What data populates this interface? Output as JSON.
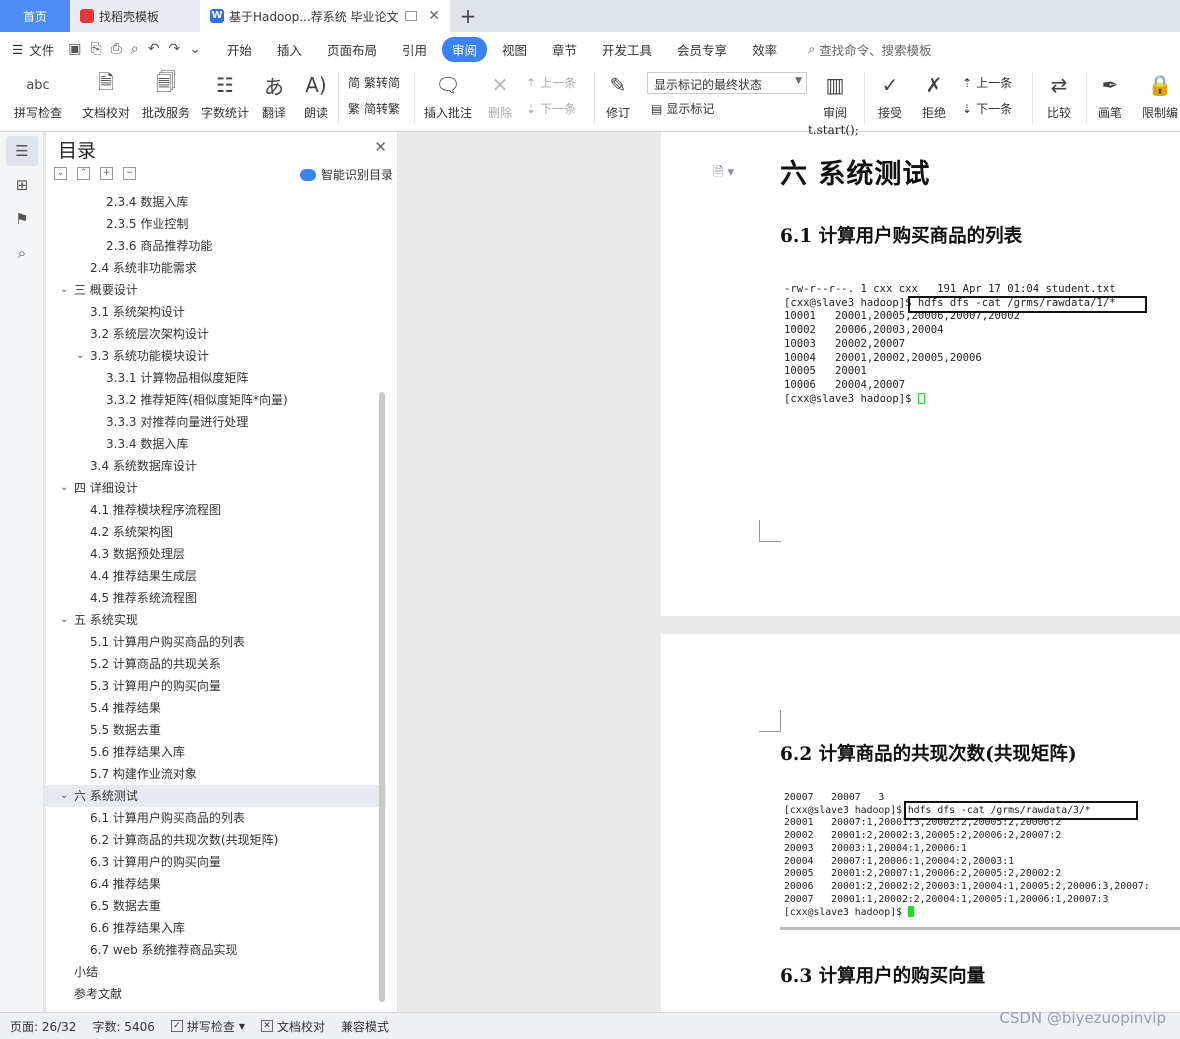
{
  "tabs": {
    "home": "首页",
    "template": "找稻壳模板",
    "doc": "基于Hadoop...荐系统 毕业论文",
    "add": "+"
  },
  "menu": {
    "file": "文件",
    "items": [
      "开始",
      "插入",
      "页面布局",
      "引用",
      "审阅",
      "视图",
      "章节",
      "开发工具",
      "会员专享",
      "效率"
    ],
    "active_index": 4,
    "search": "查找命令、搜索模板"
  },
  "ribbon": {
    "spell_check": "拼写检查",
    "doc_proof": "文档校对",
    "batch_service": "批改服务",
    "word_count": "字数统计",
    "translate": "翻译",
    "read_aloud": "朗读",
    "trad_simp": "繁转简",
    "simp_trad": "简转繁",
    "insert_comment": "插入批注",
    "delete": "删除",
    "prev": "上一条",
    "next": "下一条",
    "revise": "修订",
    "markup_select": "显示标记的最终状态",
    "show_markup": "显示标记",
    "review": "审阅",
    "accept": "接受",
    "reject": "拒绝",
    "prev2": "上一条",
    "next2": "下一条",
    "compare": "比较",
    "draw": "画笔",
    "restrict": "限制编",
    "abc": "abc"
  },
  "toc": {
    "title": "目录",
    "smart": "智能识别目录",
    "items": [
      {
        "label": "2.3.4 数据入库",
        "level": 3
      },
      {
        "label": "2.3.5 作业控制",
        "level": 3
      },
      {
        "label": "2.3.6 商品推荐功能",
        "level": 3
      },
      {
        "label": "2.4 系统非功能需求",
        "level": 2
      },
      {
        "label": "三 概要设计",
        "level": 1,
        "expanded": true
      },
      {
        "label": "3.1 系统架构设计",
        "level": 2
      },
      {
        "label": "3.2 系统层次架构设计",
        "level": 2
      },
      {
        "label": "3.3 系统功能模块设计",
        "level": 2,
        "expanded": true
      },
      {
        "label": "3.3.1 计算物品相似度矩阵",
        "level": 3
      },
      {
        "label": "3.3.2 推荐矩阵(相似度矩阵*向量)",
        "level": 3
      },
      {
        "label": "3.3.3 对推荐向量进行处理",
        "level": 3
      },
      {
        "label": "3.3.4 数据入库",
        "level": 3
      },
      {
        "label": "3.4 系统数据库设计",
        "level": 2
      },
      {
        "label": "四 详细设计",
        "level": 1,
        "expanded": true
      },
      {
        "label": "4.1 推荐模块程序流程图",
        "level": 2
      },
      {
        "label": "4.2 系统架构图",
        "level": 2
      },
      {
        "label": "4.3 数据预处理层",
        "level": 2
      },
      {
        "label": "4.4 推荐结果生成层",
        "level": 2
      },
      {
        "label": "4.5 推荐系统流程图",
        "level": 2
      },
      {
        "label": "五 系统实现",
        "level": 1,
        "expanded": true
      },
      {
        "label": "5.1 计算用户购买商品的列表",
        "level": 2
      },
      {
        "label": "5.2 计算商品的共现关系",
        "level": 2
      },
      {
        "label": "5.3 计算用户的购买向量",
        "level": 2
      },
      {
        "label": "5.4 推荐结果",
        "level": 2
      },
      {
        "label": "5.5 数据去重",
        "level": 2
      },
      {
        "label": "5.6 推荐结果入库",
        "level": 2
      },
      {
        "label": "5.7 构建作业流对象",
        "level": 2
      },
      {
        "label": "六 系统测试",
        "level": 1,
        "expanded": true,
        "selected": true
      },
      {
        "label": "6.1 计算用户购买商品的列表",
        "level": 2
      },
      {
        "label": "6.2 计算商品的共现次数(共现矩阵)",
        "level": 2
      },
      {
        "label": "6.3 计算用户的购买向量",
        "level": 2
      },
      {
        "label": "6.4 推荐结果",
        "level": 2
      },
      {
        "label": "6.5 数据去重",
        "level": 2
      },
      {
        "label": "6.6 推荐结果入库",
        "level": 2
      },
      {
        "label": "6.7 web 系统推荐商品实现",
        "level": 2
      },
      {
        "label": "小结",
        "level": 0
      },
      {
        "label": "参考文献",
        "level": 0
      }
    ]
  },
  "doc": {
    "cut_text": "t.start();",
    "chapter": "六  系统测试",
    "h61": "6.1 计算用户购买商品的列表",
    "h62": "6.2 计算商品的共现次数(共现矩阵)",
    "h63": "6.3 计算用户的购买向量",
    "term1_lines": [
      "-rw-r--r--. 1 cxx cxx   191 Apr 17 01:04 student.txt",
      "[cxx@slave3 hadoop]$ hdfs dfs -cat /grms/rawdata/1/*",
      "10001   20001,20005,20006,20007,20002",
      "10002   20006,20003,20004",
      "10003   20002,20007",
      "10004   20001,20002,20005,20006",
      "10005   20001",
      "10006   20004,20007"
    ],
    "term1_prompt": "[cxx@slave3 hadoop]$ ",
    "term2_lines": [
      "20007   20007   3",
      "[cxx@slave3 hadoop]$ hdfs dfs -cat /grms/rawdata/3/*",
      "20001   20007:1,20001:3,20002:2,20005:2,20006:2",
      "20002   20001:2,20002:3,20005:2,20006:2,20007:2",
      "20003   20003:1,20004:1,20006:1",
      "20004   20007:1,20006:1,20004:2,20003:1",
      "20005   20001:2,20007:1,20006:2,20005:2,20002:2",
      "20006   20001:2,20002:2,20003:1,20004:1,20005:2,20006:3,20007:",
      "20007   20001:1,20002:2,20004:1,20005:1,20006:1,20007:3"
    ],
    "term2_prompt": "[cxx@slave3 hadoop]$ "
  },
  "status": {
    "page": "页面: 26/32",
    "words": "字数: 5406",
    "spell": "拼写检查",
    "proof": "文档校对",
    "compat": "兼容模式"
  },
  "watermark": "CSDN @biyezuopinvip"
}
